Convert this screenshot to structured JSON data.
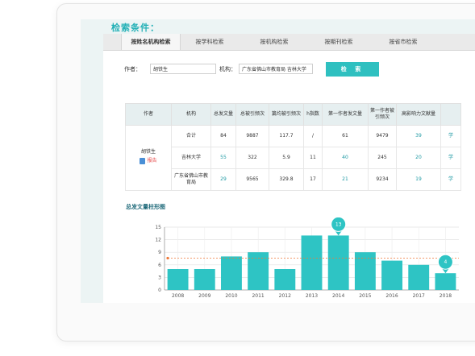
{
  "page": {
    "section_title": "检索条件："
  },
  "tabs": [
    {
      "label": "按姓名机构检索",
      "active": true
    },
    {
      "label": "按学科检索",
      "active": false
    },
    {
      "label": "按机构检索",
      "active": false
    },
    {
      "label": "按期刊检索",
      "active": false
    },
    {
      "label": "按省市检索",
      "active": false
    }
  ],
  "search": {
    "author_label": "作者：",
    "author_value": "胡铁生",
    "org_label": "机构：",
    "org_value": "广东省佛山市教育局 吉林大学",
    "button_label": "检 索"
  },
  "table": {
    "headers": [
      "作者",
      "机构",
      "总发文量",
      "总被引频次",
      "篇均被引频次",
      "h指数",
      "第一作者发文量",
      "第一作者被引频次",
      "高影响力文献量"
    ],
    "author_name": "胡铁生",
    "report_label": "报告",
    "rows": [
      {
        "org": "合计",
        "total": "84",
        "cites": "9887",
        "avg": "117.7",
        "h": "/",
        "first": "61",
        "first_cites": "9479",
        "high": "39",
        "extra": "学"
      },
      {
        "org": "吉林大学",
        "total": "55",
        "cites": "322",
        "avg": "5.9",
        "h": "11",
        "first": "40",
        "first_cites": "245",
        "high": "20",
        "extra": "学"
      },
      {
        "org": "广东省佛山市教育局",
        "total": "29",
        "cites": "9565",
        "avg": "329.8",
        "h": "17",
        "first": "21",
        "first_cites": "9234",
        "high": "19",
        "extra": "学"
      }
    ]
  },
  "chart_title": "总发文量柱形图",
  "chart_data": {
    "type": "bar",
    "categories": [
      "2008",
      "2009",
      "2010",
      "2011",
      "2012",
      "2013",
      "2014",
      "2015",
      "2016",
      "2017",
      "2018"
    ],
    "values": [
      5,
      5,
      8,
      9,
      5,
      13,
      13,
      9,
      7,
      6,
      4
    ],
    "yticks": [
      0,
      3,
      6,
      9,
      12,
      15
    ],
    "ylim": [
      0,
      15
    ],
    "average_line": 7.6,
    "max_marker": {
      "category": "2014",
      "label": "13"
    },
    "min_marker": {
      "category": "2018",
      "label": "4"
    },
    "bar_color": "#2ec4c4",
    "avg_color": "#f07a3a"
  }
}
